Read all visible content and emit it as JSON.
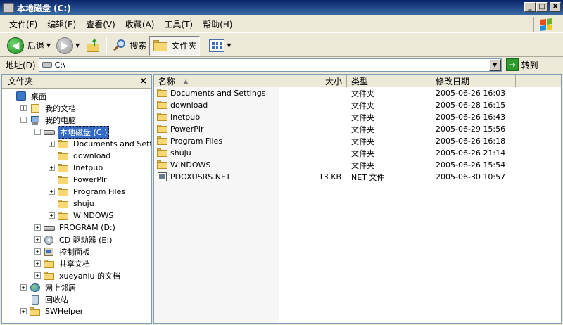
{
  "window": {
    "title": "本地磁盘 (C:)",
    "minimize": "_",
    "maximize": "□",
    "close": "X"
  },
  "menu": [
    "文件(F)",
    "编辑(E)",
    "查看(V)",
    "收藏(A)",
    "工具(T)",
    "帮助(H)"
  ],
  "toolbar": {
    "back_label": "后退",
    "search_label": "搜索",
    "folders_label": "文件夹"
  },
  "address": {
    "label": "地址(D)",
    "value": "C:\\",
    "go_label": "转到"
  },
  "folder_pane": {
    "title": "文件夹",
    "close": "×",
    "tree": [
      {
        "label": "桌面",
        "depth": 0,
        "expander": "",
        "icon": "desktop"
      },
      {
        "label": "我的文档",
        "depth": 1,
        "expander": "+",
        "icon": "docs"
      },
      {
        "label": "我的电脑",
        "depth": 1,
        "expander": "−",
        "icon": "pc"
      },
      {
        "label": "本地磁盘 (C:)",
        "depth": 2,
        "expander": "−",
        "icon": "drive",
        "selected": true
      },
      {
        "label": "Documents and Settings",
        "depth": 3,
        "expander": "+",
        "icon": "folder"
      },
      {
        "label": "download",
        "depth": 3,
        "expander": "",
        "icon": "folder"
      },
      {
        "label": "Inetpub",
        "depth": 3,
        "expander": "+",
        "icon": "folder"
      },
      {
        "label": "PowerPlr",
        "depth": 3,
        "expander": "",
        "icon": "folder"
      },
      {
        "label": "Program Files",
        "depth": 3,
        "expander": "+",
        "icon": "folder"
      },
      {
        "label": "shuju",
        "depth": 3,
        "expander": "",
        "icon": "folder"
      },
      {
        "label": "WINDOWS",
        "depth": 3,
        "expander": "+",
        "icon": "folder"
      },
      {
        "label": "PROGRAM (D:)",
        "depth": 2,
        "expander": "+",
        "icon": "drive"
      },
      {
        "label": "CD 驱动器 (E:)",
        "depth": 2,
        "expander": "+",
        "icon": "cd"
      },
      {
        "label": "控制面板",
        "depth": 2,
        "expander": "+",
        "icon": "panel"
      },
      {
        "label": "共享文档",
        "depth": 2,
        "expander": "+",
        "icon": "folder"
      },
      {
        "label": "xueyanlu 的文档",
        "depth": 2,
        "expander": "+",
        "icon": "folder"
      },
      {
        "label": "网上邻居",
        "depth": 1,
        "expander": "+",
        "icon": "network"
      },
      {
        "label": "回收站",
        "depth": 1,
        "expander": "",
        "icon": "recycle"
      },
      {
        "label": "SWHelper",
        "depth": 1,
        "expander": "+",
        "icon": "folder"
      }
    ]
  },
  "file_list": {
    "columns": {
      "name": "名称",
      "size": "大小",
      "type": "类型",
      "date": "修改日期"
    },
    "sort_indicator": "▲",
    "rows": [
      {
        "name": "Documents and Settings",
        "size": "",
        "type": "文件夹",
        "date": "2005-06-26 16:03",
        "icon": "folder"
      },
      {
        "name": "download",
        "size": "",
        "type": "文件夹",
        "date": "2005-06-28 16:15",
        "icon": "folder"
      },
      {
        "name": "Inetpub",
        "size": "",
        "type": "文件夹",
        "date": "2005-06-26 16:43",
        "icon": "folder"
      },
      {
        "name": "PowerPlr",
        "size": "",
        "type": "文件夹",
        "date": "2005-06-29 15:56",
        "icon": "folder"
      },
      {
        "name": "Program Files",
        "size": "",
        "type": "文件夹",
        "date": "2005-06-26 16:18",
        "icon": "folder"
      },
      {
        "name": "shuju",
        "size": "",
        "type": "文件夹",
        "date": "2005-06-26 21:14",
        "icon": "folder"
      },
      {
        "name": "WINDOWS",
        "size": "",
        "type": "文件夹",
        "date": "2005-06-26 15:54",
        "icon": "folder"
      },
      {
        "name": "PDOXUSRS.NET",
        "size": "13 KB",
        "type": "NET 文件",
        "date": "2005-06-30 10:57",
        "icon": "file"
      }
    ]
  },
  "colors": {
    "titlebar_start": "#0A246A",
    "titlebar_end": "#3A6EA5",
    "selection": "#316AC5",
    "chrome": "#ECE9D8",
    "folder_yellow": "#F8D774"
  }
}
